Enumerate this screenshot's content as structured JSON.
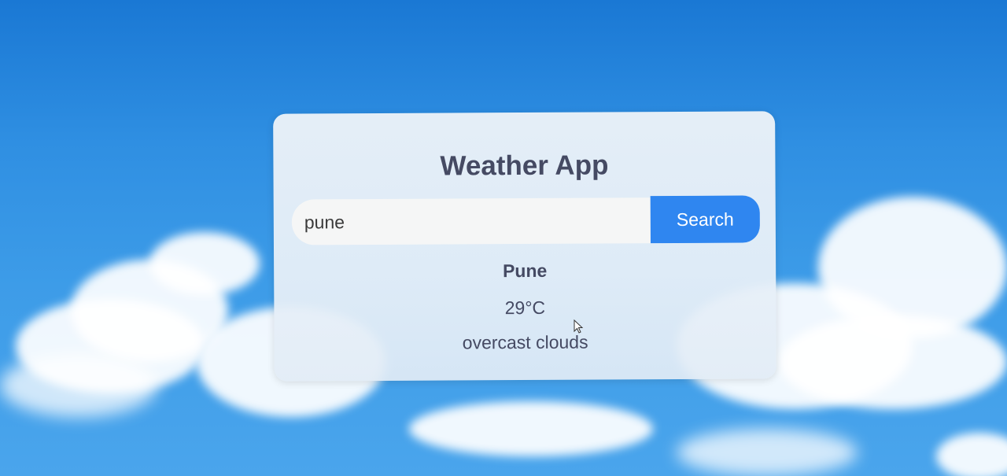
{
  "app": {
    "title": "Weather App"
  },
  "search": {
    "value": "pune",
    "placeholder": "",
    "button_label": "Search"
  },
  "weather": {
    "city": "Pune",
    "temperature": "29°C",
    "description": "overcast clouds"
  },
  "colors": {
    "accent": "#2f86f0",
    "text": "#454a63",
    "sky": "#2f8fe2"
  },
  "icons": {
    "cursor": "mouse-pointer-icon"
  }
}
